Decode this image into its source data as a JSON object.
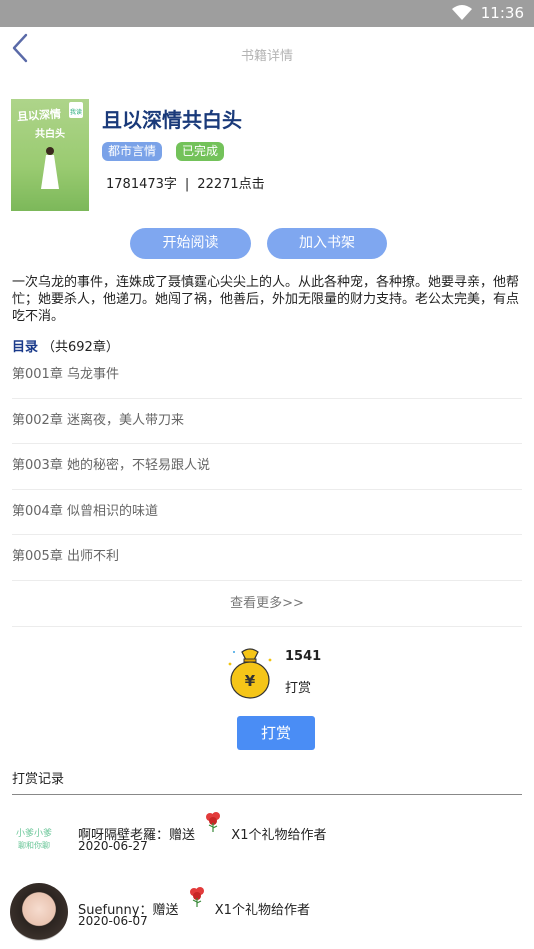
{
  "status_bar": {
    "time": "11:36"
  },
  "header": {
    "title": "书籍详情"
  },
  "book": {
    "title": "且以深情共白头",
    "cover_title": "且以深情",
    "cover_subtitle": "共白头",
    "cover_logo": "我读",
    "genre_tag": "都市言情",
    "status_tag": "已完成",
    "word_count": "1781473字",
    "separator": "|",
    "clicks": "22271点击",
    "description": "一次乌龙的事件，连姝成了聂慎霆心尖尖上的人。从此各种宠，各种撩。她要寻亲，他帮忙；她要杀人，他递刀。她闯了祸，他善后，外加无限量的财力支持。老公太完美，有点吃不消。"
  },
  "actions": {
    "read_label": "开始阅读",
    "shelf_label": "加入书架"
  },
  "toc": {
    "label": "目录",
    "count": "（共692章）",
    "chapters": [
      "第001章 乌龙事件",
      "第002章 迷离夜，美人带刀来",
      "第003章 她的秘密，不轻易跟人说",
      "第004章 似曾相识的味道",
      "第005章 出师不利"
    ],
    "more_label": "查看更多>>"
  },
  "reward": {
    "count": "1541",
    "label": "打赏",
    "button_label": "打赏",
    "bag_symbol": "¥"
  },
  "records": {
    "title": "打赏记录",
    "items": [
      {
        "avatar_top": "小爹小爹",
        "avatar_bottom": "聊和你聊",
        "user": "啊呀隔壁老羅：赠送",
        "gift": "X1个礼物给作者",
        "date": "2020-06-27"
      },
      {
        "user": "Suefunny：赠送",
        "gift": "X1个礼物给作者",
        "date": "2020-06-07"
      }
    ]
  },
  "colors": {
    "accent_button": "#7fa7f0",
    "reward_button": "#4a8df5",
    "title_blue": "#1a3a7a",
    "tag_green": "#73c25a",
    "tag_blue": "#7aa2e8"
  }
}
